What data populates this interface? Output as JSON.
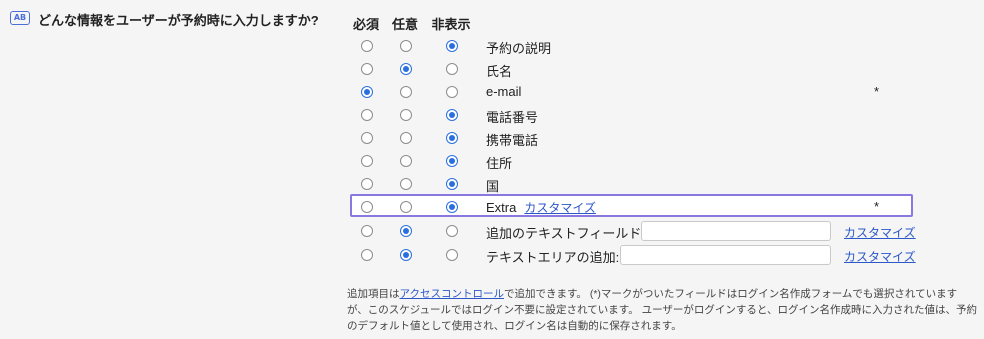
{
  "section": {
    "icon": "form-fields-icon",
    "icon_text": "AB",
    "title": "どんな情報をユーザーが予約時に入力しますか?"
  },
  "columns": {
    "required": "必須",
    "optional": "任意",
    "hidden": "非表示"
  },
  "fields": [
    {
      "label": "予約の説明",
      "state": "hidden",
      "star": ""
    },
    {
      "label": "氏名",
      "state": "optional",
      "star": ""
    },
    {
      "label": "e-mail",
      "state": "required",
      "star": "*"
    },
    {
      "label": "電話番号",
      "state": "hidden",
      "star": ""
    },
    {
      "label": "携帯電話",
      "state": "hidden",
      "star": ""
    },
    {
      "label": "住所",
      "state": "hidden",
      "star": ""
    },
    {
      "label": "国",
      "state": "hidden",
      "star": ""
    },
    {
      "label": "Extra",
      "state": "hidden",
      "star": "*",
      "customize": "カスタマイズ",
      "highlighted": true
    },
    {
      "label": "追加のテキストフィールド:",
      "state": "optional",
      "input_value": "",
      "customize": "カスタマイズ"
    },
    {
      "label": "テキストエリアの追加:",
      "state": "optional",
      "input_value": "",
      "customize": "カスタマイズ"
    }
  ],
  "note": {
    "prefix": "追加項目は",
    "link": "アクセスコントロール",
    "suffix": "で追加できます。 (*)マークがついたフィールドはログイン名作成フォームでも選択されていますが、このスケジュールではログイン不要に設定されています。 ユーザーがログインすると、ログイン名作成時に入力された値は、予約のデフォルト値として使用され、ログイン名は自動的に保存されます。"
  }
}
